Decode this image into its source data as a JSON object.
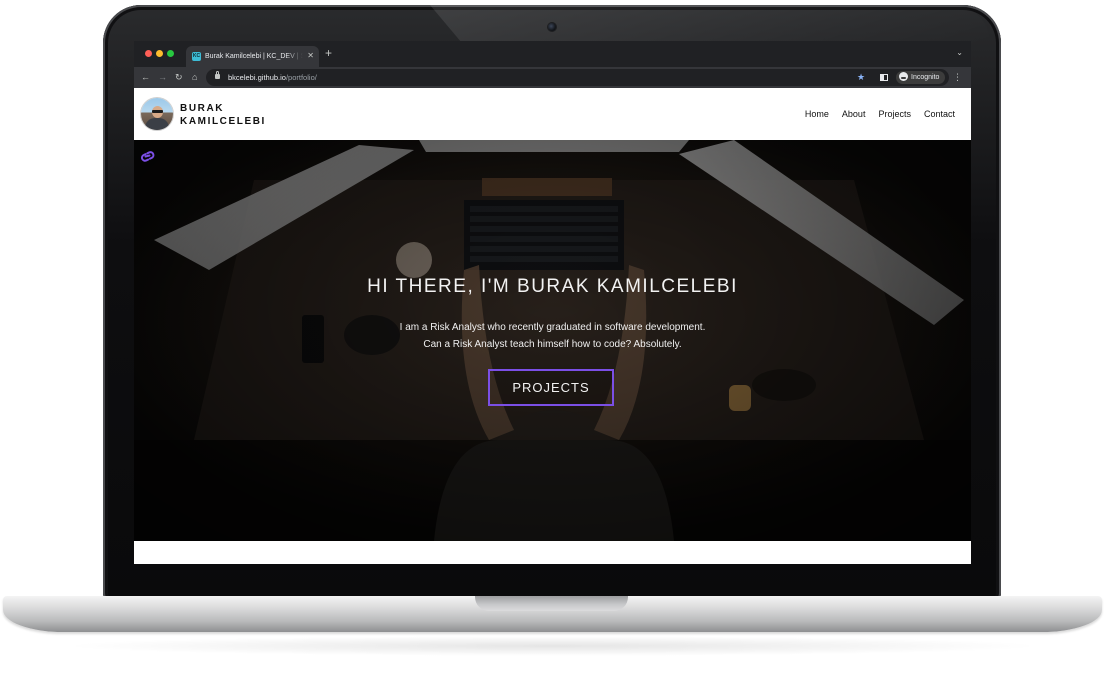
{
  "browser": {
    "tab": {
      "favicon": "KC",
      "title": "Burak Kamilcelebi | KC_DEV | S"
    },
    "url": {
      "host": "bkcelebi.github.io",
      "path": "/portfolio/"
    },
    "incognito_label": "Incognito",
    "icons": {
      "back": "arrow-left-icon",
      "forward": "arrow-right-icon",
      "reload": "reload-icon",
      "home": "home-icon"
    }
  },
  "site": {
    "brand": {
      "line1": "BURAK",
      "line2": "KAMILCELEBI"
    },
    "nav": [
      {
        "label": "Home"
      },
      {
        "label": "About"
      },
      {
        "label": "Projects"
      },
      {
        "label": "Contact"
      }
    ]
  },
  "hero": {
    "title": "HI THERE, I'M BURAK KAMILCELEBI",
    "subtitle_line1": "I am a Risk Analyst who recently graduated in software development.",
    "subtitle_line2": "Can a Risk Analyst teach himself how to code? Absolutely.",
    "button_label": "PROJECTS"
  },
  "colors": {
    "accent": "#7b4fe6",
    "chrome_dark": "#202124",
    "chrome_toolbar": "#35363a"
  }
}
